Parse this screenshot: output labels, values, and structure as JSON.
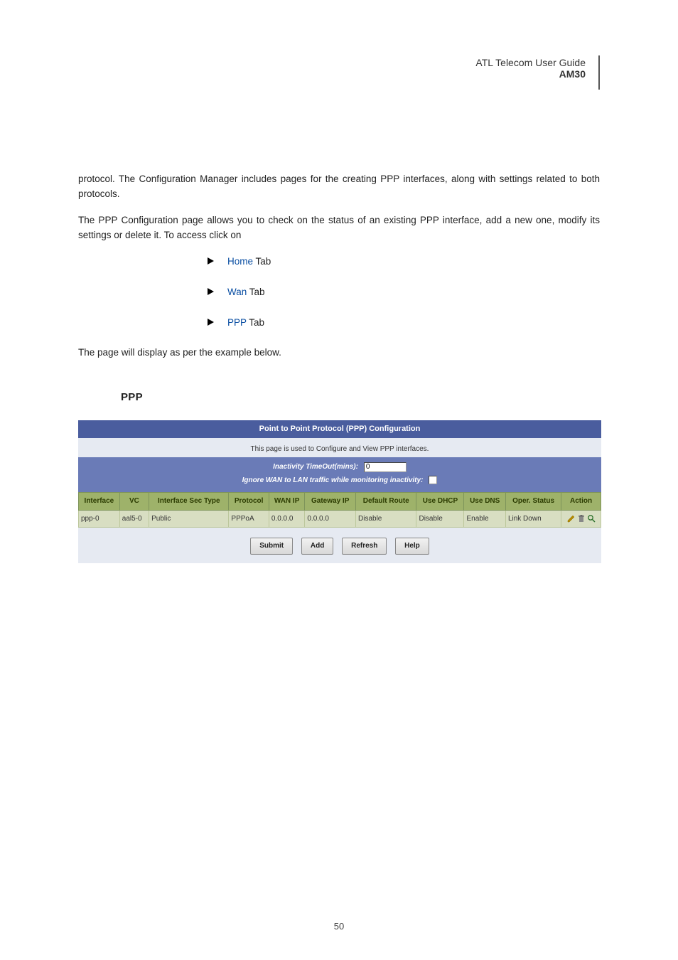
{
  "header": {
    "line1": "ATL Telecom User Guide",
    "line2": "AM30"
  },
  "para1": "protocol. The Configuration Manager includes pages for the creating PPP interfaces, along with settings related to both protocols.",
  "para2": "The PPP Configuration page allows you to check on the status of an existing PPP interface, add a new one, modify its settings or delete it. To access click on",
  "bullets": [
    {
      "label": "Home",
      "suffix": " Tab"
    },
    {
      "label": "Wan",
      "suffix": " Tab"
    },
    {
      "label": "PPP",
      "suffix": " Tab"
    }
  ],
  "para3": "The page will display as per the example below.",
  "section_label": "PPP",
  "ppp": {
    "title": "Point to Point Protocol (PPP) Configuration",
    "subtitle": "This page is used to Configure and View PPP interfaces.",
    "opt1_label": "Inactivity TimeOut(mins):",
    "opt1_value": "0",
    "opt2_label": "Ignore WAN to LAN traffic while monitoring inactivity:",
    "columns": [
      "Interface",
      "VC",
      "Interface Sec Type",
      "Protocol",
      "WAN IP",
      "Gateway IP",
      "Default Route",
      "Use DHCP",
      "Use DNS",
      "Oper. Status",
      "Action"
    ],
    "row": {
      "interface": "ppp-0",
      "vc": "aal5-0",
      "sec": "Public",
      "protocol": "PPPoA",
      "wanip": "0.0.0.0",
      "gwip": "0.0.0.0",
      "defroute": "Disable",
      "usedhcp": "Disable",
      "usedns": "Enable",
      "status": "Link Down"
    },
    "buttons": {
      "submit": "Submit",
      "add": "Add",
      "refresh": "Refresh",
      "help": "Help"
    }
  },
  "chart_data": {
    "type": "table",
    "title": "Point to Point Protocol (PPP) Configuration",
    "columns": [
      "Interface",
      "VC",
      "Interface Sec Type",
      "Protocol",
      "WAN IP",
      "Gateway IP",
      "Default Route",
      "Use DHCP",
      "Use DNS",
      "Oper. Status"
    ],
    "rows": [
      [
        "ppp-0",
        "aal5-0",
        "Public",
        "PPPoA",
        "0.0.0.0",
        "0.0.0.0",
        "Disable",
        "Disable",
        "Enable",
        "Link Down"
      ]
    ],
    "settings": {
      "Inactivity TimeOut(mins)": 0,
      "Ignore WAN to LAN traffic while monitoring inactivity": false
    }
  },
  "page_number": "50"
}
